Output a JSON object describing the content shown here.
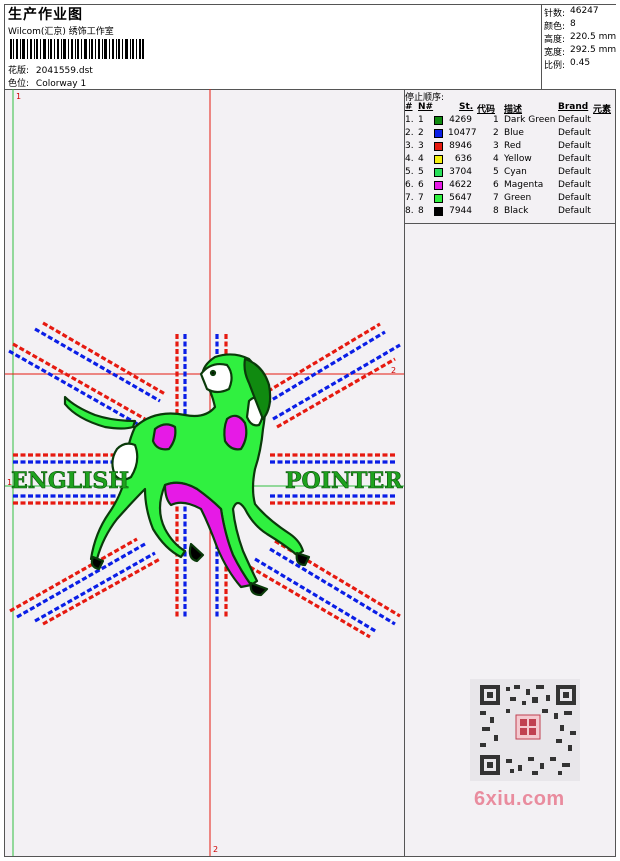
{
  "header": {
    "title": "生产作业图",
    "subtitle": "Wilcom(汇京) 绣饰工作室",
    "design_label": "花版:",
    "design_value": "2041559.dst",
    "colorway_label": "色位:",
    "colorway_value": "Colorway 1"
  },
  "stats": [
    {
      "label": "针数:",
      "value": "46247"
    },
    {
      "label": "颜色:",
      "value": "8"
    },
    {
      "label": "高度:",
      "value": "220.5 mm"
    },
    {
      "label": "宽度:",
      "value": "292.5 mm"
    },
    {
      "label": "比例:",
      "value": "0.45"
    }
  ],
  "stop_sequence": {
    "title": "停止顺序:",
    "columns": [
      "#",
      "N#",
      "St.",
      "代码",
      "描述",
      "Brand",
      "元素"
    ],
    "rows": [
      {
        "idx": "1.",
        "n": "1",
        "color": "#108a10",
        "st": "4269",
        "code": "1",
        "desc": "Dark Green",
        "brand": "Default"
      },
      {
        "idx": "2.",
        "n": "2",
        "color": "#0a1ee6",
        "st": "10477",
        "code": "2",
        "desc": "Blue",
        "brand": "Default"
      },
      {
        "idx": "3.",
        "n": "3",
        "color": "#e61a10",
        "st": "8946",
        "code": "3",
        "desc": "Red",
        "brand": "Default"
      },
      {
        "idx": "4.",
        "n": "4",
        "color": "#f4f010",
        "st": "636",
        "code": "4",
        "desc": "Yellow",
        "brand": "Default"
      },
      {
        "idx": "5.",
        "n": "5",
        "color": "#28e05a",
        "st": "3704",
        "code": "5",
        "desc": "Cyan",
        "brand": "Default"
      },
      {
        "idx": "6.",
        "n": "6",
        "color": "#e61ae6",
        "st": "4622",
        "code": "6",
        "desc": "Magenta",
        "brand": "Default"
      },
      {
        "idx": "7.",
        "n": "7",
        "color": "#30f040",
        "st": "5647",
        "code": "7",
        "desc": "Green",
        "brand": "Default"
      },
      {
        "idx": "8.",
        "n": "8",
        "color": "#000000",
        "st": "7944",
        "code": "8",
        "desc": "Black",
        "brand": "Default"
      }
    ]
  },
  "design": {
    "text_left": "ENGLISH",
    "text_right": "POINTER",
    "axis_markers": {
      "top_left": "1",
      "mid_left": "1",
      "right": "2",
      "bottom": "2"
    }
  },
  "watermark": "6xiu.com",
  "colors": {
    "red": "#e61a10",
    "blue": "#0a1ee6",
    "green": "#30f040",
    "magenta": "#e61ae6",
    "dark_green": "#108a10"
  }
}
